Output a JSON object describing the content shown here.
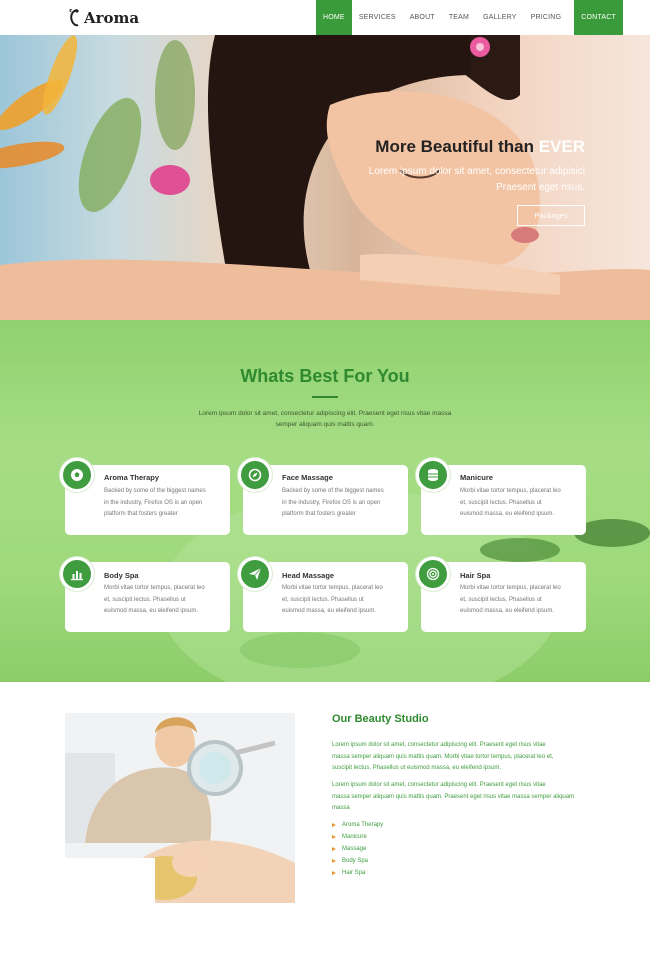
{
  "nav": {
    "brand": "Aroma",
    "items": [
      {
        "label": "HOME",
        "name": "nav-home"
      },
      {
        "label": "SERVICES",
        "name": "nav-services"
      },
      {
        "label": "ABOUT",
        "name": "nav-about"
      },
      {
        "label": "TEAM",
        "name": "nav-team"
      },
      {
        "label": "GALLERY",
        "name": "nav-gallery"
      },
      {
        "label": "PRICING",
        "name": "nav-pricing"
      }
    ],
    "contact": "CONTACT"
  },
  "hero": {
    "title_main": "More Beautiful than",
    "title_accent": "EVER",
    "subtitle_line1": "Lorem ipsum dolor sit amet, consectetur adipisici",
    "subtitle_line2": "Praesent eget risus.",
    "button": "Packages"
  },
  "services": {
    "title": "Whats Best For You",
    "desc_line1": "Lorem ipsum dolor sit amet, consectetur adipiscing elit. Praesent eget risus vitae massa",
    "desc_line2": "semper aliquam quis mattis quam.",
    "cards": [
      {
        "title": "Aroma Therapy",
        "icon": "soccer-ball-icon",
        "lines": [
          "Backed by some of the biggest names",
          "in the industry, Firefox OS is an open",
          "platform that fosters greater"
        ]
      },
      {
        "title": "Face Massage",
        "icon": "compass-icon",
        "lines": [
          "Backed by some of the biggest names",
          "in the industry, Firefox OS is an open",
          "platform that fosters greater"
        ]
      },
      {
        "title": "Manicure",
        "icon": "database-icon",
        "lines": [
          "Morbi vitae tortor tempus, placerat leo",
          "et, suscipit lectus. Phasellus ut",
          "euismod massa, eu eleifend ipsum."
        ]
      },
      {
        "title": "Body Spa",
        "icon": "bar-chart-icon",
        "lines": [
          "Morbi vitae tortor tempus, placerat leo",
          "et, suscipit lectus. Phasellus ut",
          "euismod massa, eu eleifend ipsum."
        ]
      },
      {
        "title": "Head Massage",
        "icon": "paper-plane-icon",
        "lines": [
          "Morbi vitae tortor tempus, placerat leo",
          "et, suscipit lectus. Phasellus ut",
          "euismod massa, eu eleifend ipsum."
        ]
      },
      {
        "title": "Hair Spa",
        "icon": "target-icon",
        "lines": [
          "Morbi vitae tortor tempus, placerat leo",
          "et, suscipit lectus. Phasellus ut",
          "euismod massa, eu eleifend ipsum."
        ]
      }
    ]
  },
  "studio": {
    "title": "Our Beauty Studio",
    "p1": [
      "Lorem ipsum dolor sit amet, consectetur adipiscing elit. Praesent eget risus vitae",
      "massa semper aliquam quis mattis quam. Morbi vitae tortor tempus, placerat leo et,",
      "suscipit lectus. Phasellus ut euismod massa, eu eleifend ipsum."
    ],
    "p2": [
      "Lorem ipsum dolor sit amet, consectetur adipiscing elit. Praesent eget risus vitae",
      "massa semper aliquam quis mattis quam. Praesent eget risus vitae massa semper aliquam",
      "massa"
    ],
    "list": [
      "Aroma Therapy",
      "Manicure",
      "Massage",
      "Body Spa",
      "Hair Spa"
    ]
  },
  "colors": {
    "accent": "#3a9b3a",
    "bullet": "#e8962e",
    "section_bg": "#9fd97c"
  }
}
